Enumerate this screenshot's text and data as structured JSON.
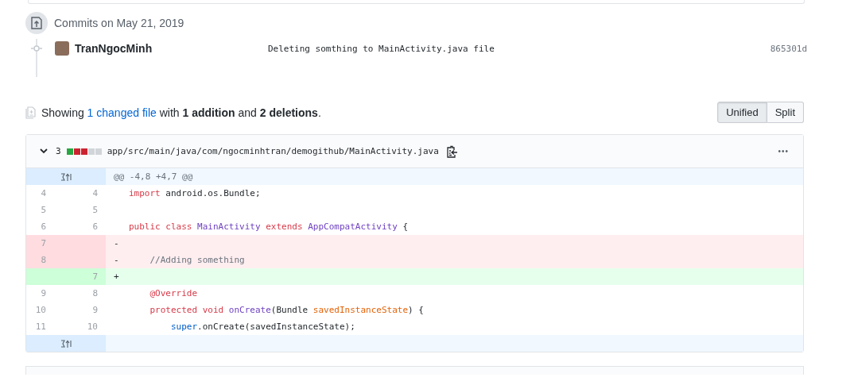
{
  "commit_group": {
    "title": "Commits on May 21, 2019",
    "commits": [
      {
        "author": "TranNgocMinh",
        "message": "Deleting somthing to MainActivity.java file",
        "sha": "865301d"
      }
    ]
  },
  "summary": {
    "before": "Showing ",
    "link": "1 changed file",
    "after": " with **1 addition** and **2 deletions**.",
    "view_modes": [
      {
        "label": "Unified",
        "selected": true
      },
      {
        "label": "Split",
        "selected": false
      }
    ]
  },
  "file": {
    "expanded": true,
    "change_count": "3",
    "diffstat": [
      {
        "kind": "added"
      },
      {
        "kind": "deleted"
      },
      {
        "kind": "deleted"
      },
      {
        "kind": "neutral"
      },
      {
        "kind": "neutral"
      }
    ],
    "path": "app/src/main/java/com/ngocminhtran/demogithub/MainActivity.java",
    "menu": "•••",
    "lines": [
      {
        "kind": "hunk",
        "text": "@@ -4,8 +4,7 @@"
      },
      {
        "kind": "context",
        "old": "4",
        "new": "4",
        "tokens": [
          {
            "text": "import ",
            "kind": "keyword"
          },
          {
            "text": "android.os.Bundle;",
            "kind": "plain"
          }
        ]
      },
      {
        "kind": "context",
        "old": "5",
        "new": "5"
      },
      {
        "kind": "context",
        "old": "6",
        "new": "6",
        "tokens": [
          {
            "text": "public ",
            "kind": "keyword"
          },
          {
            "text": "class ",
            "kind": "keyword"
          },
          {
            "text": "MainActivity ",
            "kind": "entity"
          },
          {
            "text": "extends ",
            "kind": "keyword"
          },
          {
            "text": "AppCompatActivity ",
            "kind": "entity"
          },
          {
            "text": "{",
            "kind": "plain"
          }
        ]
      },
      {
        "kind": "deletion",
        "old": "7",
        "sign": "-"
      },
      {
        "kind": "deletion",
        "old": "8",
        "sign": "-",
        "tokens": [
          {
            "text": "    //Adding something",
            "kind": "comment"
          }
        ]
      },
      {
        "kind": "addition",
        "new": "7",
        "sign": "+"
      },
      {
        "kind": "context",
        "old": "9",
        "new": "8",
        "tokens": [
          {
            "text": "    @Override",
            "kind": "keyword"
          }
        ]
      },
      {
        "kind": "context",
        "old": "10",
        "new": "9",
        "tokens": [
          {
            "text": "    protected ",
            "kind": "keyword"
          },
          {
            "text": "void ",
            "kind": "keyword"
          },
          {
            "text": "onCreate",
            "kind": "entity"
          },
          {
            "text": "(Bundle ",
            "kind": "plain"
          },
          {
            "text": "savedInstanceState",
            "kind": "variable"
          },
          {
            "text": ") {",
            "kind": "plain"
          }
        ]
      },
      {
        "kind": "context",
        "old": "11",
        "new": "10",
        "tokens": [
          {
            "text": "        super",
            "kind": "support"
          },
          {
            "text": ".onCreate(savedInstanceState);",
            "kind": "plain"
          }
        ]
      },
      {
        "kind": "expander"
      }
    ]
  }
}
